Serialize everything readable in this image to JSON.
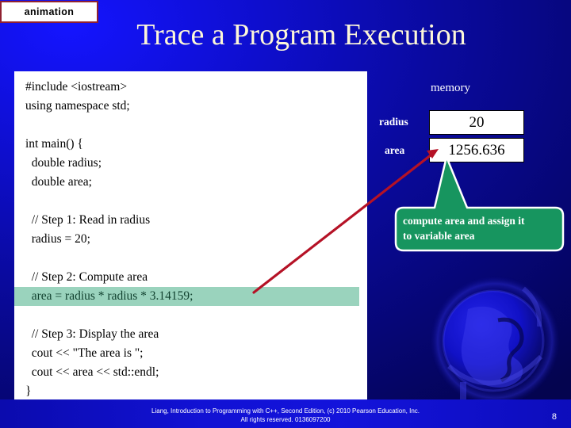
{
  "badge": {
    "label": "animation"
  },
  "title": "Trace a Program Execution",
  "code": {
    "lines": [
      {
        "text": "#include <iostream>",
        "highlight": false
      },
      {
        "text": "using namespace std;",
        "highlight": false
      },
      {
        "text": "",
        "highlight": false
      },
      {
        "text": "int main() {",
        "highlight": false
      },
      {
        "text": "  double radius;",
        "highlight": false
      },
      {
        "text": "  double area;",
        "highlight": false
      },
      {
        "text": "",
        "highlight": false
      },
      {
        "text": "  // Step 1: Read in radius",
        "highlight": false
      },
      {
        "text": "  radius = 20;",
        "highlight": false
      },
      {
        "text": "",
        "highlight": false
      },
      {
        "text": "  // Step 2: Compute area",
        "highlight": false
      },
      {
        "text": "  area = radius * radius * 3.14159;",
        "highlight": true
      },
      {
        "text": "",
        "highlight": false
      },
      {
        "text": "  // Step 3: Display the area",
        "highlight": false
      },
      {
        "text": "  cout << \"The area is \";",
        "highlight": false
      },
      {
        "text": "  cout << area << std::endl;",
        "highlight": false
      },
      {
        "text": "}",
        "highlight": false
      }
    ],
    "highlight_color": "#9ad3bd",
    "highlight_text_color": "#10402e"
  },
  "memory": {
    "heading": "memory",
    "rows": [
      {
        "name": "radius",
        "value": "20"
      },
      {
        "name": "area",
        "value": "1256.636"
      }
    ]
  },
  "callout": {
    "line1": "compute area and assign it",
    "line2": "to variable area",
    "fill": "#17955f",
    "border": "#ffffff"
  },
  "arrow": {
    "color": "#b51226"
  },
  "footer": {
    "line1": "Liang, Introduction to Programming with C++, Second Edition, (c) 2010 Pearson Education, Inc.",
    "line2": "All rights reserved. 0136097200",
    "page": "8"
  },
  "icons": {
    "globe": "globe-icon"
  }
}
